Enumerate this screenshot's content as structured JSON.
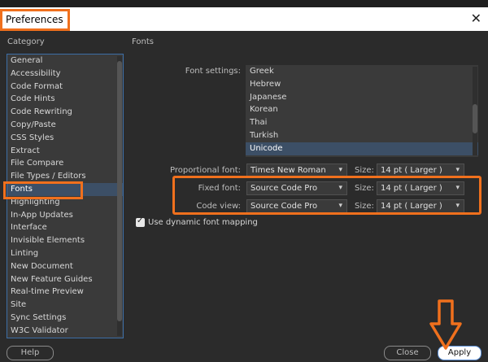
{
  "window": {
    "title": "Preferences"
  },
  "category": {
    "header": "Category",
    "items": [
      "General",
      "Accessibility",
      "Code Format",
      "Code Hints",
      "Code Rewriting",
      "Copy/Paste",
      "CSS Styles",
      "Extract",
      "File Compare",
      "File Types / Editors",
      "Fonts",
      "Highlighting",
      "In-App Updates",
      "Interface",
      "Invisible Elements",
      "Linting",
      "New Document",
      "New Feature Guides",
      "Real-time Preview",
      "Site",
      "Sync Settings",
      "W3C Validator"
    ],
    "selected": "Fonts"
  },
  "fonts": {
    "section_title": "Fonts",
    "font_settings_label": "Font settings:",
    "font_settings_items": [
      "Greek",
      "Hebrew",
      "Japanese",
      "Korean",
      "Thai",
      "Turkish",
      "Unicode"
    ],
    "font_settings_selected": "Unicode",
    "proportional_label": "Proportional font:",
    "proportional_value": "Times New Roman",
    "fixed_label": "Fixed font:",
    "fixed_value": "Source Code Pro",
    "codeview_label": "Code view:",
    "codeview_value": "Source Code Pro",
    "size_label": "Size:",
    "proportional_size": "14 pt  ( Larger )",
    "fixed_size": "14 pt  ( Larger )",
    "codeview_size": "14 pt  ( Larger )",
    "dynamic_mapping_label": "Use dynamic font mapping",
    "dynamic_mapping_checked": true
  },
  "buttons": {
    "help": "Help",
    "close": "Close",
    "apply": "Apply"
  },
  "highlight_color": "#f0701d",
  "accent_color": "#3c4f66"
}
